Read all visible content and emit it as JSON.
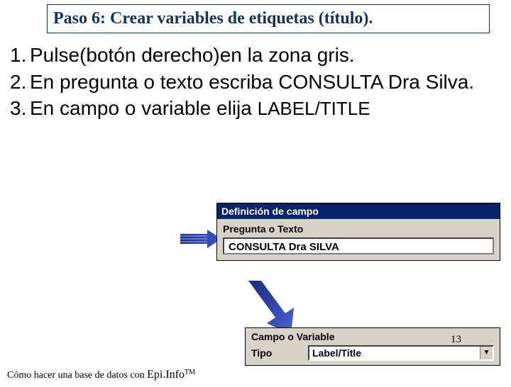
{
  "title": "Paso 6: Crear variables de etiquetas (título).",
  "steps": [
    {
      "n": "1.",
      "text": "Pulse(botón derecho)en la zona gris."
    },
    {
      "n": "2.",
      "text": "En pregunta o texto escriba CONSULTA Dra Silva."
    },
    {
      "n": "3.",
      "text_a": "En campo o variable elija ",
      "text_b": "LABEL/TITLE"
    }
  ],
  "dialog1": {
    "titlebar": "Definición de campo",
    "label": "Pregunta o Texto",
    "value": "CONSULTA Dra SILVA"
  },
  "dialog2": {
    "section": "Campo o Variable",
    "type_label": "Tipo",
    "type_value": "Label/Title",
    "chevron": "▼"
  },
  "footer": {
    "text": "Cómo hacer una base de datos con ",
    "brand": "Epi.Info",
    "tm": "TM"
  },
  "page": "13"
}
